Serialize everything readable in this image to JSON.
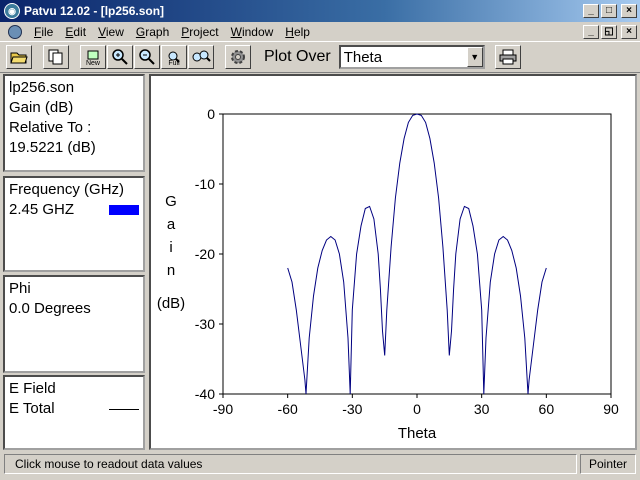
{
  "window": {
    "title": "Patvu 12.02 - [lp256.son]",
    "controls": [
      "_",
      "□",
      "×"
    ],
    "doc_controls": [
      "_",
      "◱",
      "×"
    ]
  },
  "menu": {
    "items": [
      {
        "label": "File",
        "key": "F",
        "rest": "ile"
      },
      {
        "label": "Edit",
        "key": "E",
        "rest": "dit"
      },
      {
        "label": "View",
        "key": "V",
        "rest": "iew"
      },
      {
        "label": "Graph",
        "key": "G",
        "rest": "raph"
      },
      {
        "label": "Project",
        "key": "P",
        "rest": "roject"
      },
      {
        "label": "Window",
        "key": "W",
        "rest": "indow"
      },
      {
        "label": "Help",
        "key": "H",
        "rest": "elp"
      }
    ]
  },
  "toolbar": {
    "new_label": "New",
    "full_label": "Full",
    "plot_over_label": "Plot Over",
    "plot_over_value": "Theta",
    "icons": [
      "open-folder-icon",
      "copy-icon",
      "new-icon",
      "zoom-in-icon",
      "zoom-out-icon",
      "zoom-full-icon",
      "zoom-multi-icon",
      "settings-gear-icon",
      "printer-icon"
    ]
  },
  "left_panels": {
    "file": {
      "filename": "lp256.son",
      "quantity": "Gain (dB)",
      "relative_to_label": "Relative To :",
      "relative_to_value": "19.5221 (dB)"
    },
    "frequency": {
      "header": "Frequency (GHz)",
      "value": "2.45 GHZ",
      "color": "#0000ff"
    },
    "phi": {
      "header": "Phi",
      "value": "0.0 Degrees"
    },
    "field": {
      "header": "E Field",
      "value": "E Total"
    }
  },
  "status": {
    "message": "Click mouse to readout data values",
    "mode": "Pointer"
  },
  "chart_data": {
    "type": "line",
    "xlabel": "Theta",
    "ylabel_chars": [
      "G",
      "a",
      "i",
      "n"
    ],
    "ylabel_unit": "(dB)",
    "xlim": [
      -90,
      90
    ],
    "ylim": [
      -40,
      0
    ],
    "xticks": [
      -90,
      -60,
      -30,
      0,
      30,
      60,
      90
    ],
    "yticks": [
      0,
      -10,
      -20,
      -30,
      -40
    ],
    "grid": false,
    "series": [
      {
        "color": "#000080",
        "x": [
          -60,
          -58,
          -56,
          -54,
          -52,
          -51.5,
          -51.5,
          -50,
          -48,
          -46,
          -44,
          -42,
          -40,
          -38,
          -36,
          -34,
          -32,
          -31,
          -31,
          -30,
          -28,
          -26,
          -24,
          -22,
          -20,
          -18,
          -17,
          -16,
          -15,
          -14,
          -12,
          -10,
          -8,
          -6,
          -4,
          -2,
          0,
          2,
          4,
          6,
          8,
          10,
          12,
          14,
          15,
          16,
          17,
          18,
          20,
          22,
          24,
          26,
          28,
          30,
          31,
          31,
          32,
          34,
          36,
          38,
          40,
          42,
          44,
          46,
          48,
          50,
          51.5,
          51.5,
          52,
          54,
          56,
          58,
          60
        ],
        "y": [
          -22,
          -24,
          -28,
          -33,
          -38,
          -40,
          -40,
          -32,
          -26,
          -22,
          -19.5,
          -18,
          -17.5,
          -18,
          -20,
          -24,
          -32,
          -40,
          -40,
          -28,
          -20,
          -16,
          -13.5,
          -13.2,
          -15,
          -20,
          -25,
          -31,
          -34.5,
          -28,
          -19,
          -12,
          -7,
          -3.5,
          -1.2,
          -0.2,
          0,
          -0.2,
          -1.2,
          -3.5,
          -7,
          -12,
          -19,
          -28,
          -34.5,
          -31,
          -25,
          -20,
          -15,
          -13.2,
          -13.5,
          -16,
          -20,
          -28,
          -40,
          -40,
          -32,
          -24,
          -20,
          -18,
          -17.5,
          -18,
          -19.5,
          -22,
          -26,
          -32,
          -40,
          -40,
          -38,
          -33,
          -28,
          -24,
          -22
        ]
      }
    ]
  }
}
